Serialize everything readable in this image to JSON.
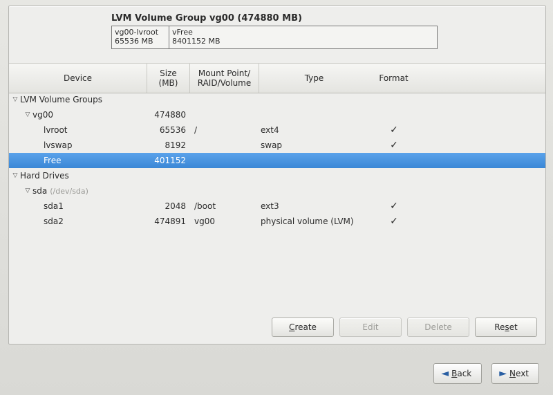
{
  "summary": {
    "title": "LVM Volume Group vg00 (474880 MB)",
    "segments": [
      {
        "name": "vg00-lvroot",
        "size": "65536 MB"
      },
      {
        "name": "vFree",
        "size": "8401152 MB"
      }
    ]
  },
  "columns": {
    "device": "Device",
    "size": "Size\n(MB)",
    "mount": "Mount Point/\nRAID/Volume",
    "type": "Type",
    "format": "Format"
  },
  "groups": {
    "lvm_label": "LVM Volume Groups",
    "hd_label": "Hard Drives"
  },
  "rows": {
    "vg00": {
      "device": "vg00",
      "size": "474880",
      "mount": "",
      "type": "",
      "format": ""
    },
    "lvroot": {
      "device": "lvroot",
      "size": "65536",
      "mount": "/",
      "type": "ext4",
      "format": "✓"
    },
    "lvswap": {
      "device": "lvswap",
      "size": "8192",
      "mount": "",
      "type": "swap",
      "format": "✓"
    },
    "free": {
      "device": "Free",
      "size": "401152",
      "mount": "",
      "type": "",
      "format": ""
    },
    "sda": {
      "device": "sda",
      "path": "(/dev/sda)",
      "size": "",
      "mount": "",
      "type": "",
      "format": ""
    },
    "sda1": {
      "device": "sda1",
      "size": "2048",
      "mount": "/boot",
      "type": "ext3",
      "format": "✓"
    },
    "sda2": {
      "device": "sda2",
      "size": "474891",
      "mount": "vg00",
      "type": "physical volume (LVM)",
      "format": "✓"
    }
  },
  "buttons": {
    "create": "Create",
    "edit": "Edit",
    "delete": "Delete",
    "reset": "Reset"
  },
  "nav": {
    "back": "Back",
    "next": "Next"
  }
}
